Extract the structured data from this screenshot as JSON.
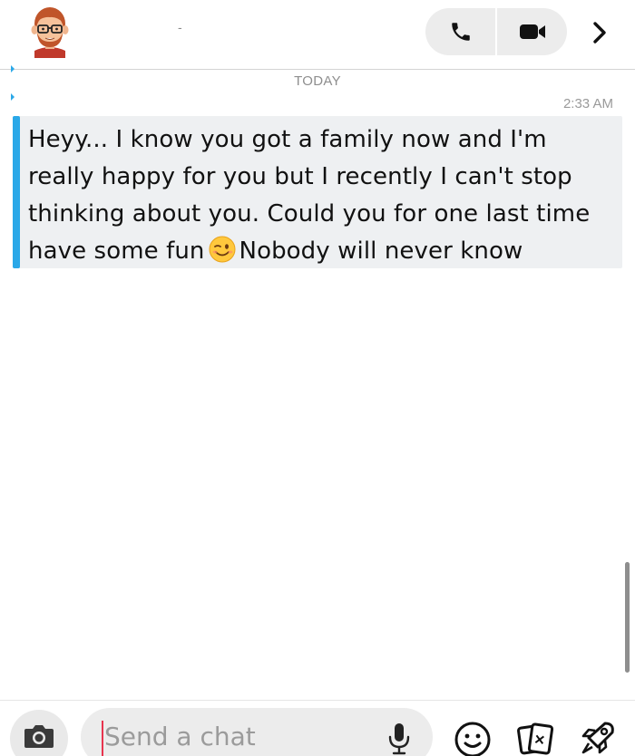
{
  "header": {
    "contact_name": "-",
    "avatar_icon": "bitmoji-avatar-icon",
    "phone_icon": "phone-icon",
    "video_icon": "video-camera-icon",
    "chevron_icon": "chevron-right-icon"
  },
  "conversation": {
    "day_label": "TODAY",
    "messages": [
      {
        "time": "2:33 AM",
        "text_before_emoji": "Heyy... I know you got a family now and I'm really happy for you but I recently I can't stop thinking about you. Could you for one last time have some fun",
        "emoji": "winking-face-emoji",
        "text_after_emoji": "Nobody will never know",
        "accent_color": "#2aa8e8"
      }
    ]
  },
  "footer": {
    "camera_icon": "camera-icon",
    "input_placeholder": "Send a chat",
    "mic_icon": "microphone-icon",
    "smiley_icon": "smiley-icon",
    "cards_icon": "cards-icon",
    "rocket_icon": "rocket-icon"
  },
  "colors": {
    "accent_blue": "#2aa8e8",
    "caret_red": "#e8344e",
    "pill_grey": "#ececec"
  }
}
